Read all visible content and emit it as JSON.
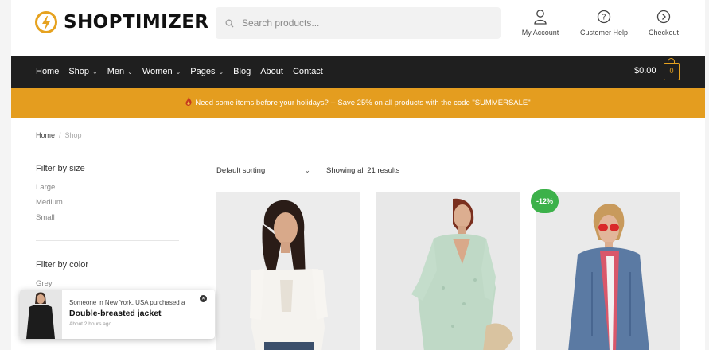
{
  "header": {
    "logo_text": "SHOPTIMIZER",
    "search_placeholder": "Search products...",
    "links": [
      {
        "label": "My Account",
        "icon": "user-icon"
      },
      {
        "label": "Customer Help",
        "icon": "help-icon"
      },
      {
        "label": "Checkout",
        "icon": "checkout-icon"
      }
    ]
  },
  "nav": {
    "items": [
      {
        "label": "Home",
        "dropdown": false
      },
      {
        "label": "Shop",
        "dropdown": true
      },
      {
        "label": "Men",
        "dropdown": true
      },
      {
        "label": "Women",
        "dropdown": true
      },
      {
        "label": "Pages",
        "dropdown": true
      },
      {
        "label": "Blog",
        "dropdown": false
      },
      {
        "label": "About",
        "dropdown": false
      },
      {
        "label": "Contact",
        "dropdown": false
      }
    ],
    "cart_total": "$0.00",
    "cart_count": "0"
  },
  "promo": {
    "text": "Need some items before your holidays? -- Save 25% on all products with the code \"SUMMERSALE\"",
    "icon": "flame-icon"
  },
  "breadcrumb": {
    "home": "Home",
    "separator": "/",
    "current": "Shop"
  },
  "sidebar": {
    "size_title": "Filter by size",
    "sizes": [
      "Large",
      "Medium",
      "Small"
    ],
    "color_title": "Filter by color",
    "colors": [
      "Grey"
    ]
  },
  "toolbar": {
    "sorting": "Default sorting",
    "results": "Showing all 21 results"
  },
  "products": {
    "sale_badge": "-12%"
  },
  "popup": {
    "line1": "Someone in New York, USA purchased a",
    "title": "Double-breasted jacket",
    "time": "About 2 hours ago"
  },
  "colors": {
    "accent": "#e49d1f",
    "nav_bg": "#1f1f1f",
    "sale_badge": "#3cb14a"
  }
}
